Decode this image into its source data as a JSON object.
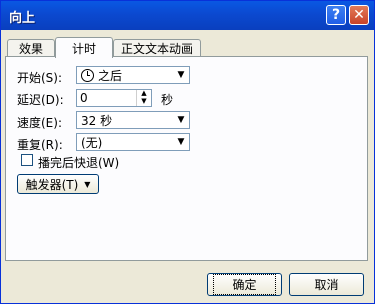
{
  "window": {
    "title": "向上"
  },
  "title_buttons": {
    "help": "?",
    "close": "✕"
  },
  "tabs": [
    {
      "label": "效果"
    },
    {
      "label": "计时"
    },
    {
      "label": "正文文本动画"
    }
  ],
  "timing": {
    "start": {
      "label": "开始(S):",
      "value": "之后",
      "icon": "clock-icon"
    },
    "delay": {
      "label": "延迟(D):",
      "value": "0",
      "unit": "秒"
    },
    "speed": {
      "label": "速度(E):",
      "value": "32 秒"
    },
    "repeat": {
      "label": "重复(R):",
      "value": "(无)"
    },
    "rewind": {
      "label": "播完后快退(W)",
      "checked": false
    },
    "trigger_label": "触发器(T)"
  },
  "buttons": {
    "ok": "确定",
    "cancel": "取消"
  }
}
